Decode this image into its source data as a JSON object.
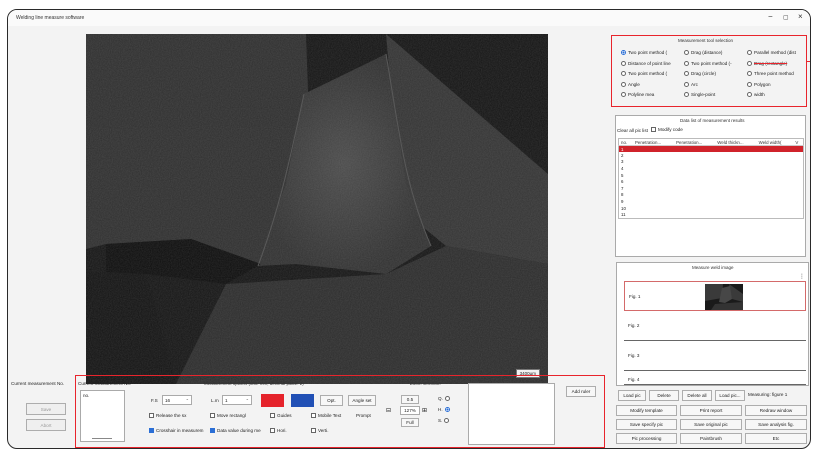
{
  "window": {
    "title": "Welding line measure software",
    "minimize": "−",
    "maximize": "▢",
    "close": "×"
  },
  "viewport": {
    "scalebar": "3400μm"
  },
  "tools": {
    "title": "Measurement tool selection",
    "options": [
      {
        "label": "Two point method (",
        "selected": true
      },
      {
        "label": "Drag (distance)",
        "selected": false
      },
      {
        "label": "Parallel method (dist",
        "selected": false
      },
      {
        "label": "Distance of point line",
        "selected": false
      },
      {
        "label": "Two point method (-",
        "selected": false
      },
      {
        "label": "Drag (rectangle)",
        "selected": false
      },
      {
        "label": "Two point method (",
        "selected": false
      },
      {
        "label": "Drag (circle)",
        "selected": false
      },
      {
        "label": "Three point method",
        "selected": false
      },
      {
        "label": "Angle",
        "selected": false
      },
      {
        "label": "Arc",
        "selected": false
      },
      {
        "label": "Polygon",
        "selected": false
      },
      {
        "label": "Polyline mea",
        "selected": false
      },
      {
        "label": "Single-point",
        "selected": false
      },
      {
        "label": "width",
        "selected": false
      }
    ]
  },
  "results": {
    "title": "Data list of measurement results",
    "clear_label": "Clear all pic list",
    "modify_label": "Modify code",
    "columns": [
      "no.",
      "Penetration...",
      "Penetration...",
      "Weld thickn...",
      "Weld width(",
      "V"
    ],
    "rows": [
      "1",
      "2",
      "3",
      "4",
      "5",
      "6",
      "7",
      "8",
      "9",
      "10",
      "11"
    ]
  },
  "images": {
    "title": "Measure weld image",
    "items": [
      "Fig. 1",
      "Fig. 2",
      "Fig. 3",
      "Fig. 4"
    ],
    "load_pic": "Load pic",
    "delete": "Delete",
    "delete_all": "Delete all",
    "load_pic2": "Load pic...",
    "measuring": "Measuring: figure 1"
  },
  "actions": {
    "modify_template": "Modify template",
    "print_report": "Print report",
    "redraw_window": "Redraw window",
    "save_specify_pic": "Save specify pic",
    "save_original_pic": "Save original pic",
    "save_analysis_fig": "Save analysis fig.",
    "pic_processing": "Pic processing",
    "paintbrush": "Paintbrush",
    "etc": "Etc"
  },
  "bottom": {
    "current_label": "Current measurement No.",
    "current_label2": "Current measurement No.",
    "no_label": "no.",
    "save": "Save",
    "abort": "Abort",
    "options_title": "Measurement options (unit: mm, decimal place: 2)",
    "fs_label": "F.S",
    "fs_value": "16",
    "lm_label": "L.m",
    "lm_value": "1",
    "color1": "#e5232b",
    "color2": "#2150b5",
    "opt": "Opt.",
    "angle_set": "Angle set",
    "release": "Release the sx",
    "move_rect": "Move rectangl",
    "guides": "Guides",
    "mobile_text": "Mobile Text",
    "prompt": "Prompt",
    "crosshair": "Crosshair in measurem",
    "data_value": "Data value during me",
    "hori": "Hori.",
    "verti": "Verti.",
    "zoom_title": "Zoom selection",
    "zoom_small": "0.5",
    "zoom_value": "127%",
    "zoom_full": "Full",
    "radio_q": "Q.",
    "radio_h": "H.",
    "radio_s": "S.",
    "add_ruler": "Add ruler"
  }
}
